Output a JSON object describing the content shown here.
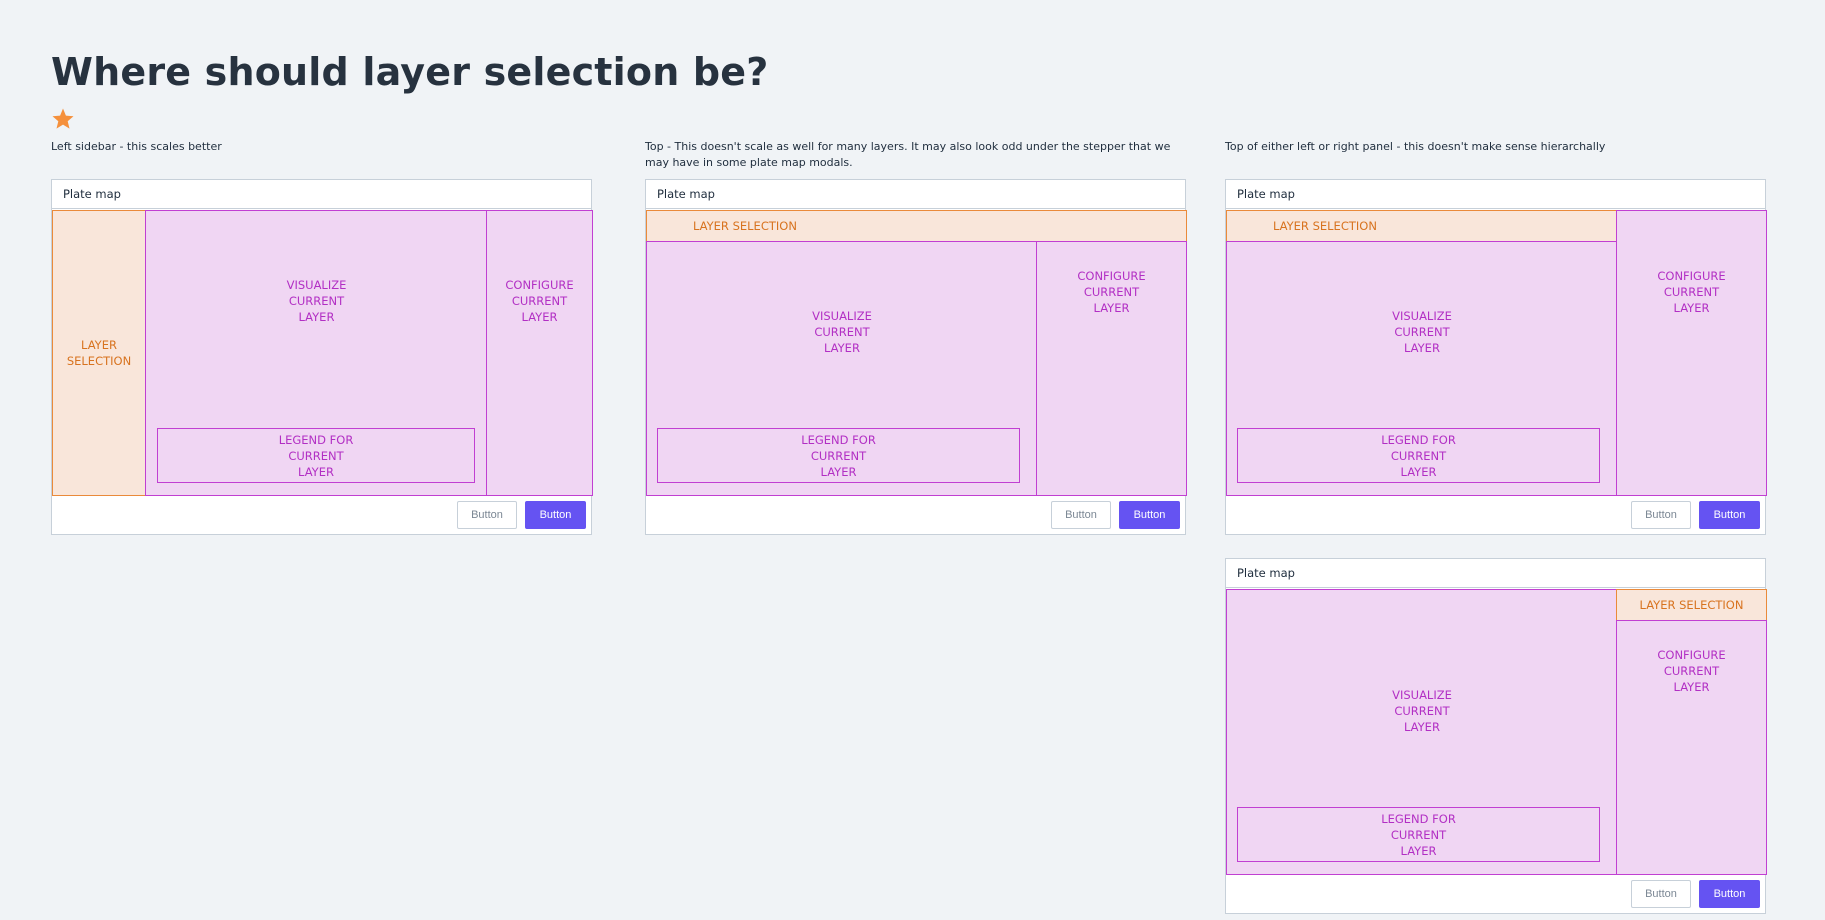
{
  "title": "Where should layer selection be?",
  "star": {
    "icon": "star-icon",
    "color": "#f5903c"
  },
  "options": [
    {
      "caption": "Left sidebar - this scales better",
      "window_title": "Plate map",
      "layer_selection": "LAYER\nSELECTION",
      "visualize": "VISUALIZE\nCURRENT\nLAYER",
      "configure": "CONFIGURE\nCURRENT\nLAYER",
      "legend": "LEGEND FOR\nCURRENT\nLAYER",
      "secondary_button": "Button",
      "primary_button": "Button"
    },
    {
      "caption": "Top - This doesn't scale as well for many layers. It may also look odd under the stepper that we may have in some plate map modals.",
      "window_title": "Plate map",
      "layer_selection": "LAYER SELECTION",
      "visualize": "VISUALIZE\nCURRENT\nLAYER",
      "configure": "CONFIGURE\nCURRENT\nLAYER",
      "legend": "LEGEND FOR\nCURRENT\nLAYER",
      "secondary_button": "Button",
      "primary_button": "Button"
    },
    {
      "caption": "Top of either left or right panel - this doesn't make sense hierarchally",
      "window_title": "Plate map",
      "layer_selection": "LAYER SELECTION",
      "visualize": "VISUALIZE\nCURRENT\nLAYER",
      "configure": "CONFIGURE\nCURRENT\nLAYER",
      "legend": "LEGEND FOR\nCURRENT\nLAYER",
      "secondary_button": "Button",
      "primary_button": "Button"
    },
    {
      "window_title": "Plate map",
      "layer_selection": "LAYER SELECTION",
      "visualize": "VISUALIZE\nCURRENT\nLAYER",
      "configure": "CONFIGURE\nCURRENT\nLAYER",
      "legend": "LEGEND FOR\nCURRENT\nLAYER",
      "secondary_button": "Button",
      "primary_button": "Button"
    }
  ],
  "colors": {
    "primary_button": "#6553f2",
    "region_pink": "#f0d6f3",
    "region_pink_border": "#c13fd2",
    "region_orange": "#f9e6da",
    "region_orange_border": "#ea8a3a",
    "background": "#f0f3f6"
  }
}
